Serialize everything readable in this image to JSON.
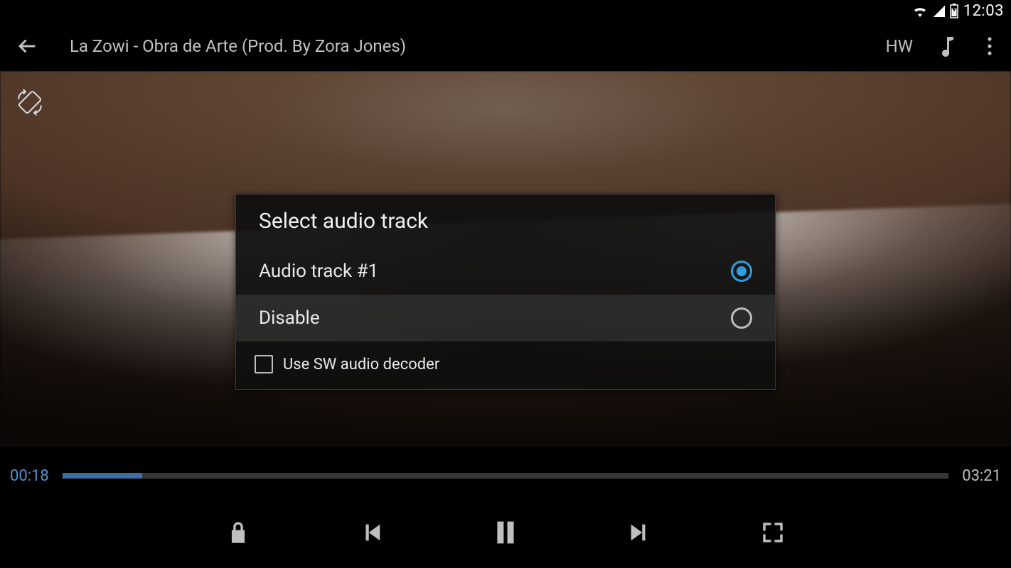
{
  "statusbar": {
    "time": "12:03"
  },
  "appbar": {
    "title": "La Zowi - Obra de Arte (Prod. By Zora Jones)",
    "decoder_label": "HW"
  },
  "player": {
    "current_time": "00:18",
    "total_time": "03:21",
    "progress_percent": 9
  },
  "dialog": {
    "title": "Select audio track",
    "options": [
      {
        "label": "Audio track #1",
        "selected": true
      },
      {
        "label": "Disable",
        "selected": false
      }
    ],
    "checkbox_label": "Use SW audio decoder",
    "checkbox_checked": false
  }
}
